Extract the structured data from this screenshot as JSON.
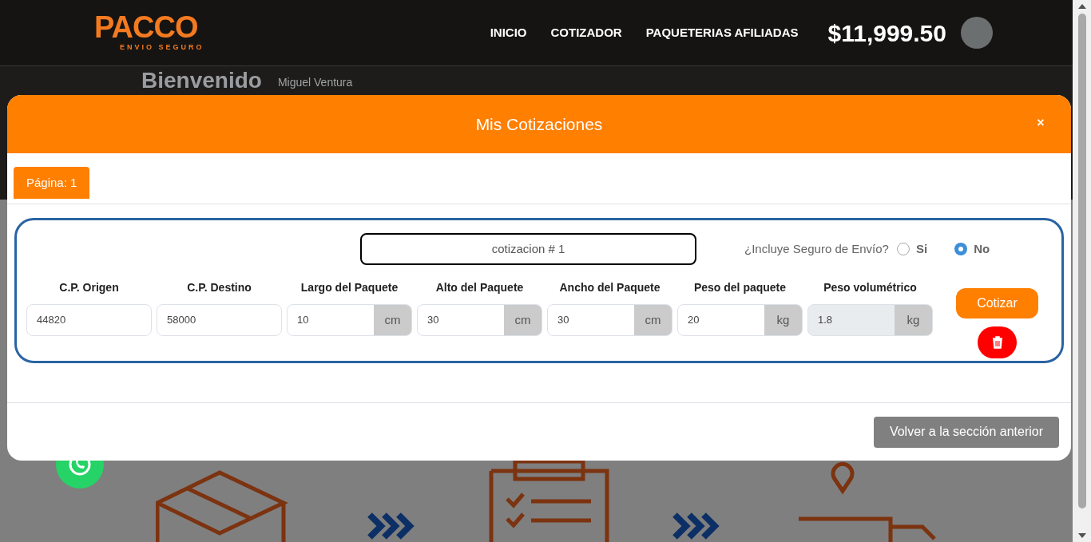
{
  "header": {
    "logo": {
      "word": "PACCO",
      "tagline": "ENVIO SEGURO"
    },
    "nav": [
      "INICIO",
      "COTIZADOR",
      "PAQUETERIAS AFILIADAS"
    ],
    "balance": "$11,999.50"
  },
  "welcome": {
    "title": "Bienvenido",
    "name": "Miguel Ventura"
  },
  "modal": {
    "title": "Mis Cotizaciones",
    "close": "×",
    "tabs": [
      {
        "label": "Página: 1",
        "selected": true
      }
    ],
    "quote": {
      "name": "cotizacion # 1",
      "insurance": {
        "question": "¿Incluye Seguro de Envío?",
        "options": [
          {
            "label": "Si",
            "selected": false
          },
          {
            "label": "No",
            "selected": true
          }
        ]
      },
      "fields": [
        {
          "label": "C.P. Origen",
          "value": "44820",
          "disabled": false
        },
        {
          "label": "C.P. Destino",
          "value": "58000",
          "disabled": false
        },
        {
          "label": "Largo del Paquete",
          "value": "10",
          "unit": "cm",
          "disabled": false
        },
        {
          "label": "Alto del Paquete",
          "value": "30",
          "unit": "cm",
          "disabled": false
        },
        {
          "label": "Ancho del Paquete",
          "value": "30",
          "unit": "cm",
          "disabled": false
        },
        {
          "label": "Peso del paquete",
          "value": "20",
          "unit": "kg",
          "disabled": false
        },
        {
          "label": "Peso volumétrico",
          "value": "1.8",
          "unit": "kg",
          "disabled": true
        }
      ],
      "quote_button": "Cotizar"
    },
    "back_button": "Volver a la sección anterior"
  }
}
